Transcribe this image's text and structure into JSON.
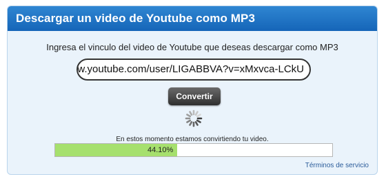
{
  "header": {
    "title": "Descargar un video de Youtube como MP3"
  },
  "form": {
    "instruction": "Ingresa el vinculo del video de Youtube que deseas descargar como MP3",
    "url_value": "www.youtube.com/user/LIGABBVA?v=xMxvca-LCkU",
    "convert_label": "Convertir"
  },
  "progress": {
    "status_text": "En estos momento estamos convirtiendo tu video.",
    "percent": 44.1,
    "percent_label": "44.10%"
  },
  "footer": {
    "terms_label": "Términos de servicio"
  },
  "colors": {
    "header": "#1f74c6",
    "progress_fill": "#a6e06e",
    "panel_bg": "#eaf3fb"
  },
  "icons": {
    "spinner": "loading-spinner-icon"
  }
}
